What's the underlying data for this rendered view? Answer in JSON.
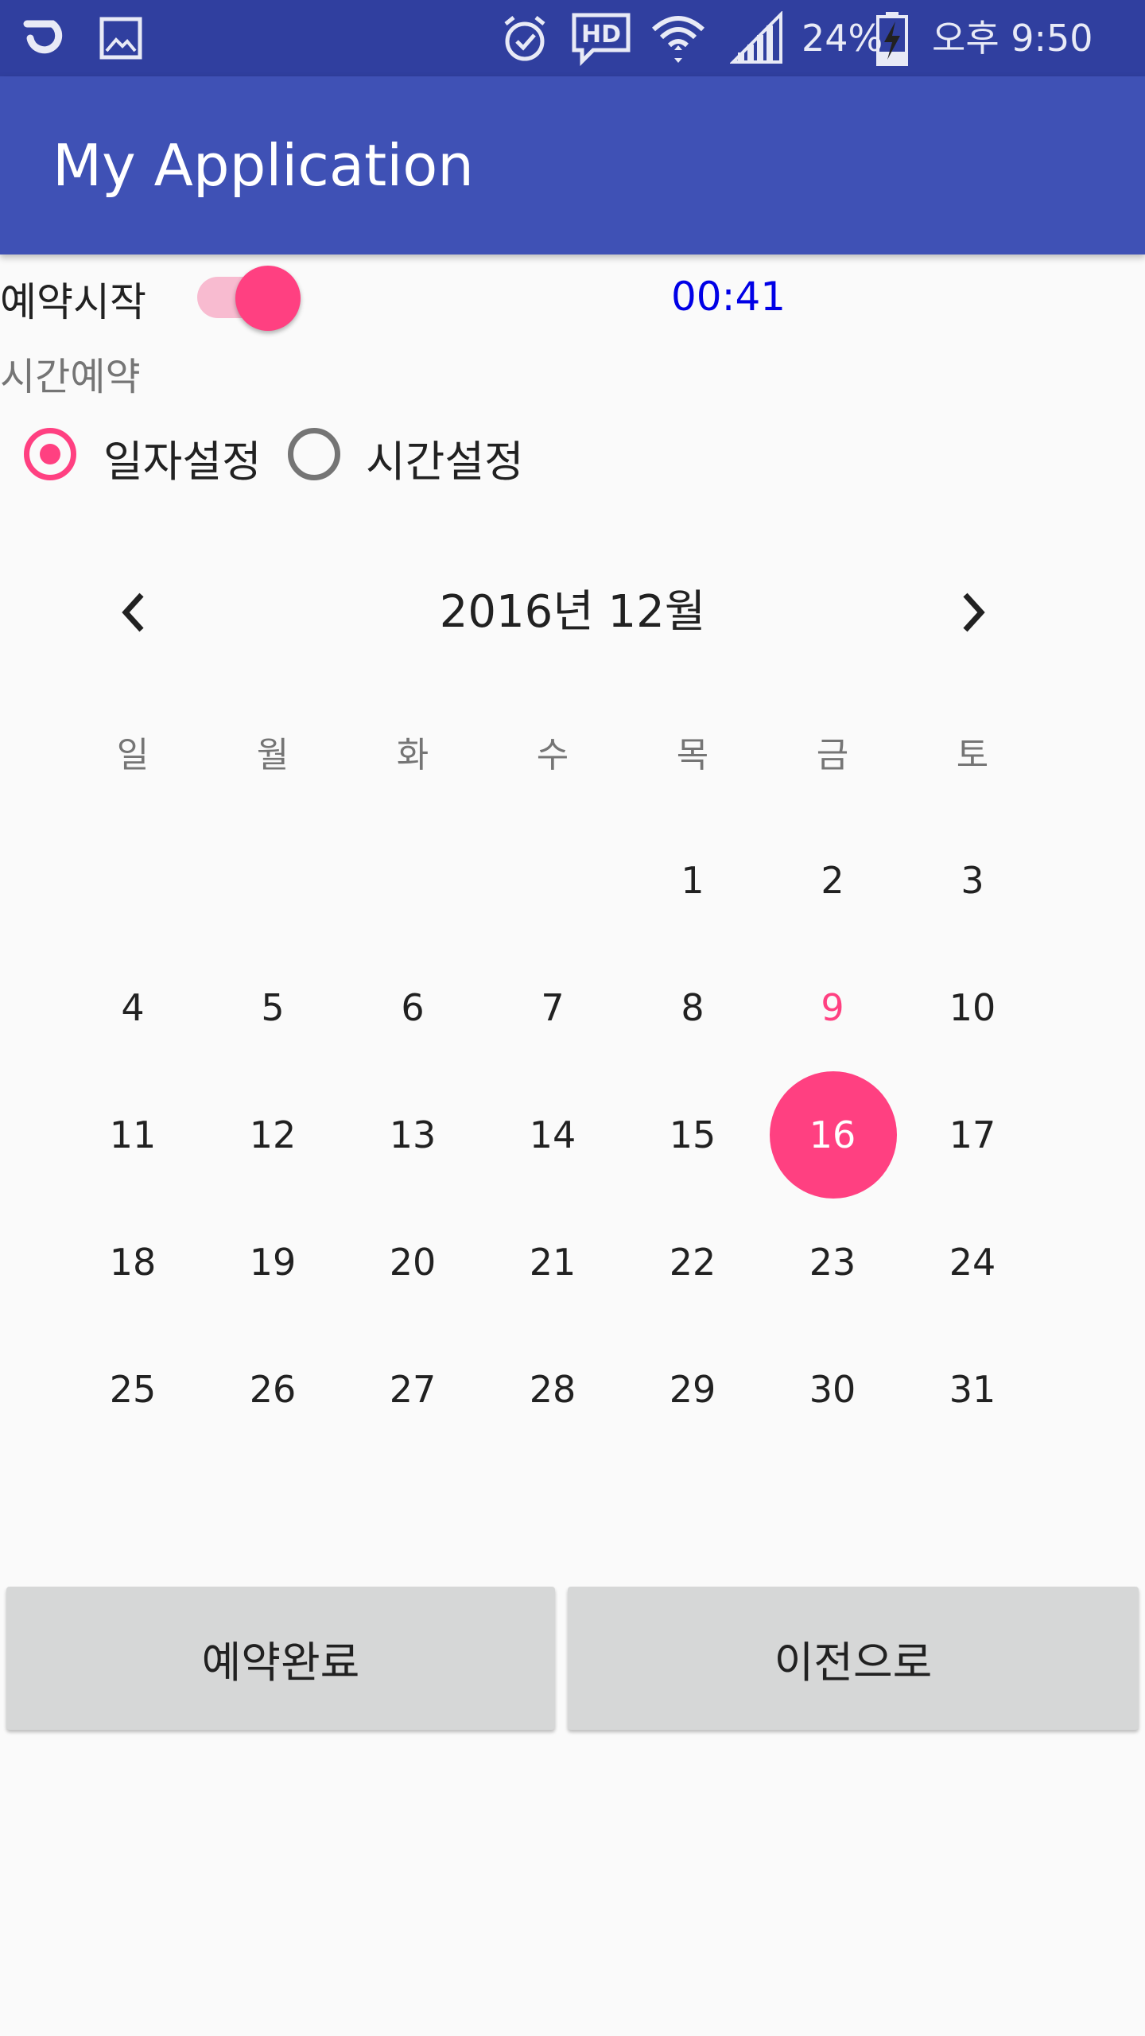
{
  "status_bar": {
    "battery": "24%",
    "time": "오후 9:50",
    "icons": [
      "app-o-icon",
      "gallery-icon",
      "alarm-icon",
      "hd-voice-icon",
      "wifi-icon",
      "signal-icon",
      "battery-charging-icon"
    ]
  },
  "app_bar": {
    "title": "My Application"
  },
  "reservation": {
    "switch_label": "예약시작",
    "switch_on": true,
    "timer": "00:41",
    "section_label": "시간예약"
  },
  "radios": [
    {
      "label": "일자설정",
      "checked": true
    },
    {
      "label": "시간설정",
      "checked": false
    }
  ],
  "calendar": {
    "month_label": "2016년 12월",
    "weekdays": [
      "일",
      "월",
      "화",
      "수",
      "목",
      "금",
      "토"
    ],
    "first_weekday_index": 4,
    "days": [
      "1",
      "2",
      "3",
      "4",
      "5",
      "6",
      "7",
      "8",
      "9",
      "10",
      "11",
      "12",
      "13",
      "14",
      "15",
      "16",
      "17",
      "18",
      "19",
      "20",
      "21",
      "22",
      "23",
      "24",
      "25",
      "26",
      "27",
      "28",
      "29",
      "30",
      "31"
    ],
    "today": "9",
    "selected": "16"
  },
  "buttons": {
    "complete": "예약완료",
    "previous": "이전으로"
  },
  "colors": {
    "status_bar": "#303f9f",
    "app_bar": "#3f51b5",
    "accent": "#ff4081",
    "timer": "#0000e6"
  }
}
